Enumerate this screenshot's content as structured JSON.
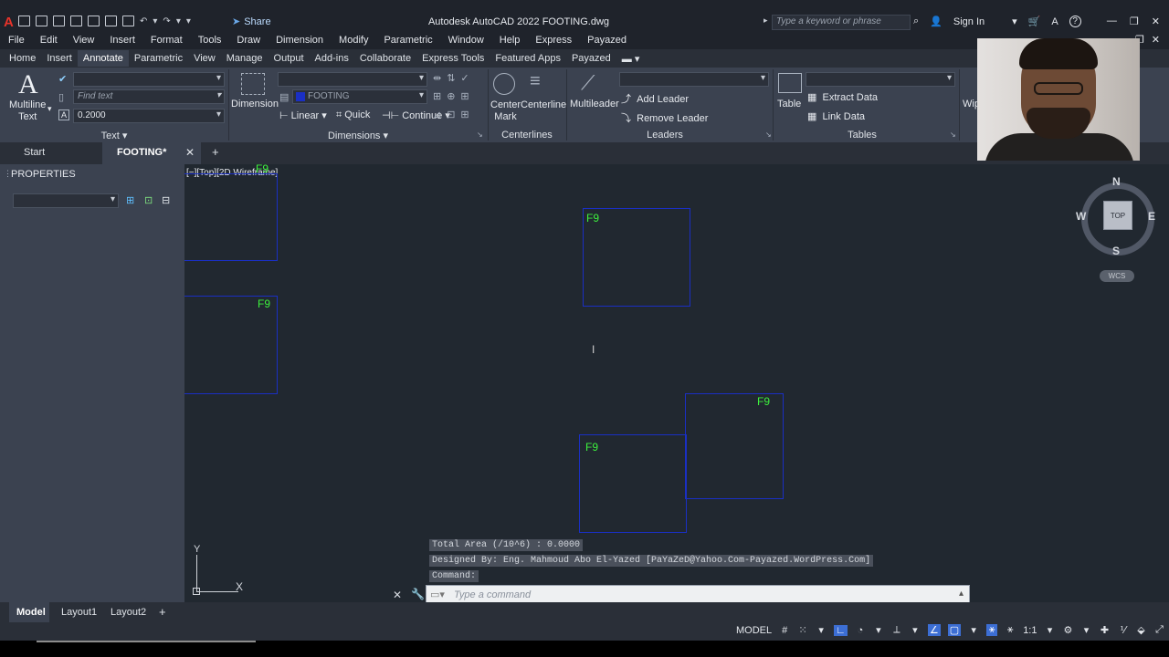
{
  "titlebar": {
    "logo": "A",
    "share_label": "Share",
    "title": "Autodesk AutoCAD 2022    FOOTING.dwg",
    "search_placeholder": "Type a keyword or phrase",
    "sign_in": "Sign In",
    "help": "?"
  },
  "menu": [
    "File",
    "Edit",
    "View",
    "Insert",
    "Format",
    "Tools",
    "Draw",
    "Dimension",
    "Modify",
    "Parametric",
    "Window",
    "Help",
    "Express",
    "Payazed"
  ],
  "ribbon_tabs": [
    "Home",
    "Insert",
    "Annotate",
    "Parametric",
    "View",
    "Manage",
    "Output",
    "Add-ins",
    "Collaborate",
    "Express Tools",
    "Featured Apps",
    "Payazed"
  ],
  "ribbon": {
    "text_panel": {
      "multiline_text": "Multiline\nText",
      "find_placeholder": "Find text",
      "height_value": "0.2000",
      "title": "Text"
    },
    "dimensions_panel": {
      "dimension": "Dimension",
      "style_value": "FOOTING",
      "linear": "Linear",
      "quick": "Quick",
      "continue": "Continue",
      "title": "Dimensions"
    },
    "centerlines_panel": {
      "center_mark": "Center\nMark",
      "centerline": "Centerline",
      "title": "Centerlines"
    },
    "leaders_panel": {
      "multileader": "Multileader",
      "add_leader": "Add Leader",
      "remove_leader": "Remove Leader",
      "title": "Leaders"
    },
    "tables_panel": {
      "table": "Table",
      "extract_data": "Extract Data",
      "link_data": "Link Data",
      "title": "Tables"
    },
    "wipeout_partial": "Wip"
  },
  "doc_tabs": {
    "start": "Start",
    "active": "FOOTING*"
  },
  "properties": {
    "title": "PROPERTIES"
  },
  "viewport": {
    "label": "[−][Top][2D Wireframe]",
    "footing_label": "F9",
    "viewcube": {
      "n": "N",
      "s": "S",
      "e": "E",
      "w": "W",
      "face": "TOP",
      "wcs": "WCS"
    },
    "ucs": {
      "x": "X",
      "y": "Y"
    }
  },
  "command": {
    "history": [
      "Total Area (/10^6) : 0.0000",
      "Designed By: Eng. Mahmoud Abo El-Yazed [PaYaZeD@Yahoo.Com-Payazed.WordPress.Com]",
      "Command:"
    ],
    "placeholder": "Type a command"
  },
  "layout_tabs": [
    "Model",
    "Layout1",
    "Layout2"
  ],
  "status": {
    "model": "MODEL",
    "scale": "1:1"
  },
  "colors": {
    "footing_outline": "#1a2fc4",
    "footing_label": "#3df23d",
    "canvas_bg": "#212830",
    "ribbon_bg": "#3b4250"
  }
}
